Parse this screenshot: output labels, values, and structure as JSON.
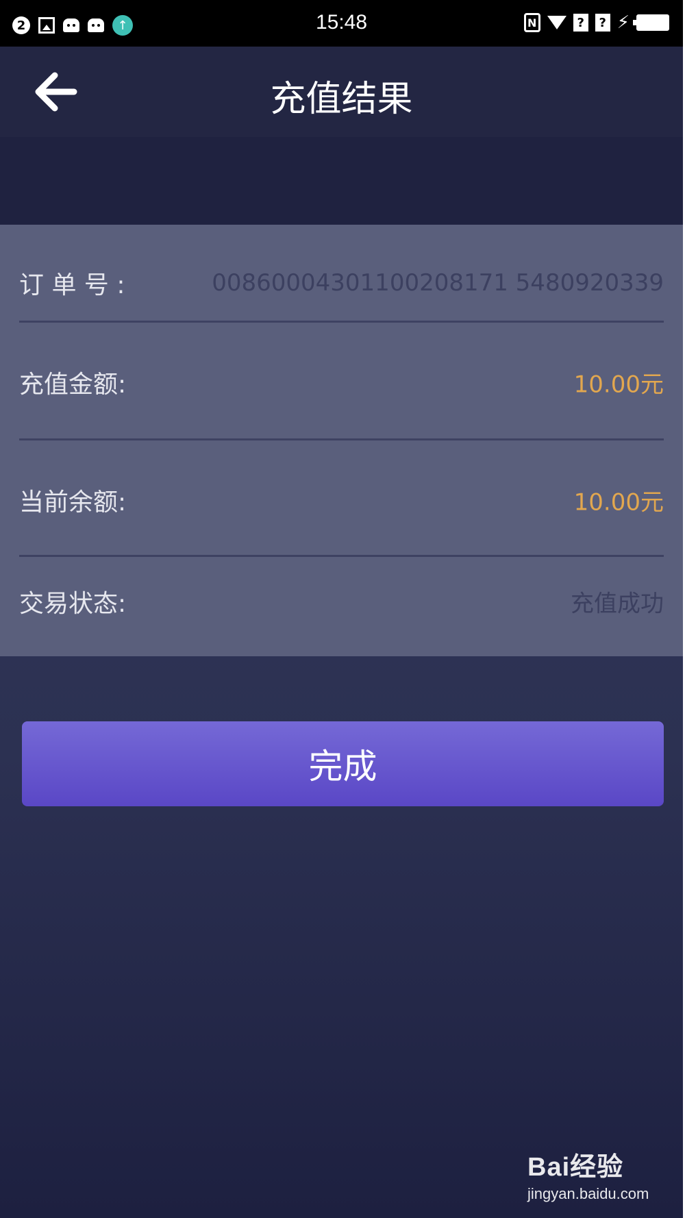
{
  "status_bar": {
    "time": "15:48",
    "notification_badge": "2",
    "icons": [
      "badge-icon",
      "image-icon",
      "robot-icon",
      "robot-icon",
      "upload-icon",
      "nfc-icon",
      "wifi-icon",
      "sim-icon",
      "sim-icon",
      "charging-icon",
      "battery-icon"
    ]
  },
  "header": {
    "title": "充值结果",
    "back_icon": "arrow-left-icon"
  },
  "details": {
    "order_number": {
      "label": "订 单 号 :",
      "value": "00860004301100208171 5480920339"
    },
    "recharge_amount": {
      "label": "充值金额:",
      "value": "10.00元"
    },
    "current_balance": {
      "label": "当前余额:",
      "value": "10.00元"
    },
    "transaction_status": {
      "label": "交易状态:",
      "value": "充值成功"
    }
  },
  "actions": {
    "done_label": "完成"
  },
  "watermark": {
    "logo": "Bai经验",
    "url": "jingyan.baidu.com"
  },
  "colors": {
    "accent_button": "#6b5ad0",
    "amount_gold": "#e2a74f",
    "card_bg": "#5a5f7c",
    "header_bg": "#232643"
  }
}
